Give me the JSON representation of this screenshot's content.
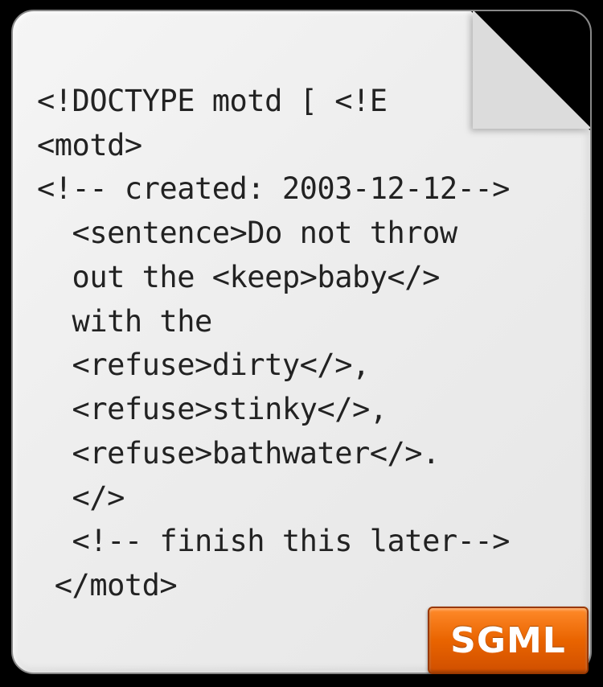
{
  "document": {
    "lines": [
      "<!DOCTYPE motd [ <!E",
      "<motd>",
      "<!-- created: 2003-12-12-->",
      "  <sentence>Do not throw",
      "  out the <keep>baby</>",
      "  with the",
      "  <refuse>dirty</>,",
      "  <refuse>stinky</>,",
      "  <refuse>bathwater</>.",
      "  </>",
      "  <!-- finish this later-->",
      " </motd>"
    ]
  },
  "badge": {
    "label": "SGML"
  }
}
